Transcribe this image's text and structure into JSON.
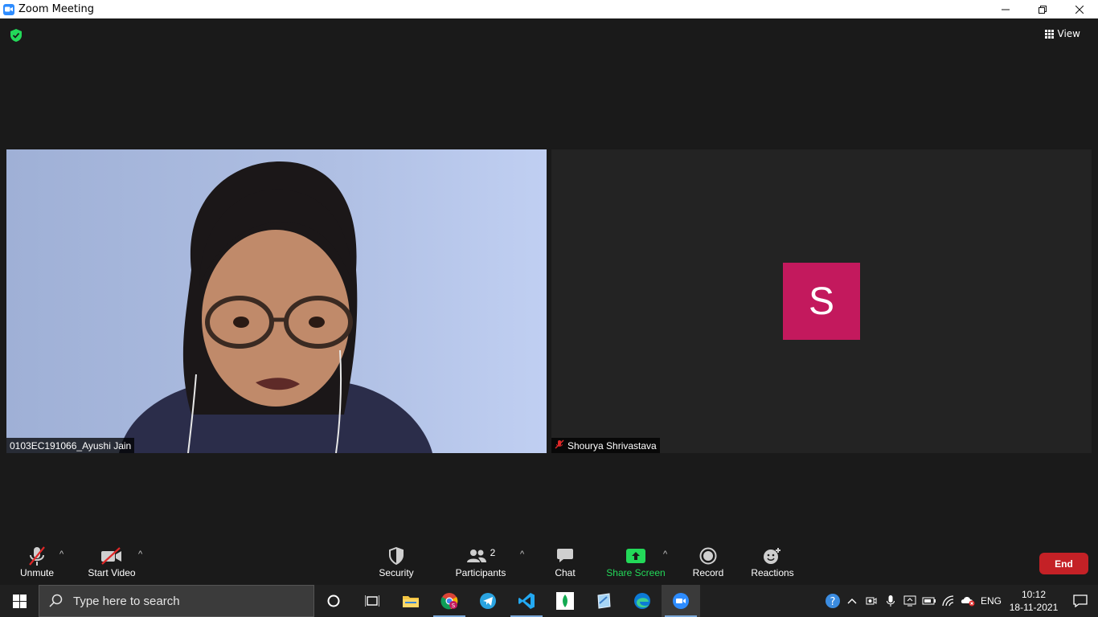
{
  "window": {
    "title": "Zoom Meeting"
  },
  "view_button": {
    "label": "View"
  },
  "participants": [
    {
      "name": "0103EC191066_Ayushi Jain",
      "video": true
    },
    {
      "name": "Shourya Shrivastava",
      "video": false,
      "muted": true,
      "initial": "S",
      "avatar_color": "#c3195d"
    }
  ],
  "toolbar": {
    "unmute": "Unmute",
    "start_video": "Start Video",
    "security": "Security",
    "participants": "Participants",
    "participants_count": "2",
    "chat": "Chat",
    "share_screen": "Share Screen",
    "record": "Record",
    "reactions": "Reactions",
    "end": "End"
  },
  "taskbar": {
    "search_placeholder": "Type here to search",
    "language": "ENG",
    "time": "10:12",
    "date": "18-11-2021"
  },
  "colors": {
    "share_green": "#23d959",
    "end_red": "#c42126",
    "mute_red": "#e02828"
  }
}
